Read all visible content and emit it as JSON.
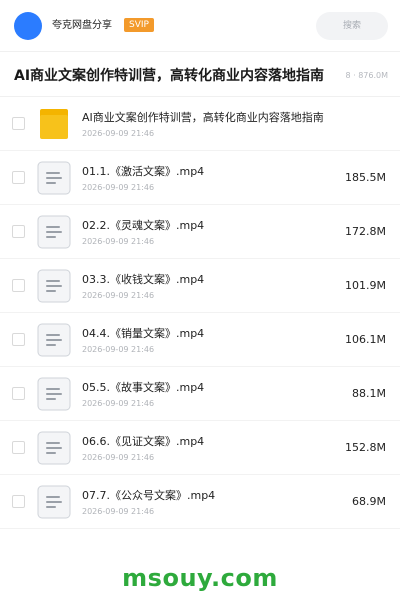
{
  "header": {
    "username": "夸克网盘分享",
    "badge": "SVIP",
    "search_placeholder": "搜索"
  },
  "folder": {
    "title": "AI商业文案创作特训营，高转化商业内容落地指南",
    "meta": "8 · 876.0M"
  },
  "files": [
    {
      "name": "AI商业文案创作特训营，高转化商业内容落地指南",
      "date": "2026-09-09 21:46",
      "size": "",
      "icon": "folder-icon"
    },
    {
      "name": "01.1.《激活文案》.mp4",
      "date": "2026-09-09 21:46",
      "size": "185.5M",
      "icon": "video-file-icon"
    },
    {
      "name": "02.2.《灵魂文案》.mp4",
      "date": "2026-09-09 21:46",
      "size": "172.8M",
      "icon": "video-file-icon"
    },
    {
      "name": "03.3.《收钱文案》.mp4",
      "date": "2026-09-09 21:46",
      "size": "101.9M",
      "icon": "video-file-icon"
    },
    {
      "name": "04.4.《销量文案》.mp4",
      "date": "2026-09-09 21:46",
      "size": "106.1M",
      "icon": "video-file-icon"
    },
    {
      "name": "05.5.《故事文案》.mp4",
      "date": "2026-09-09 21:46",
      "size": "88.1M",
      "icon": "video-file-icon"
    },
    {
      "name": "06.6.《见证文案》.mp4",
      "date": "2026-09-09 21:46",
      "size": "152.8M",
      "icon": "video-file-icon"
    },
    {
      "name": "07.7.《公众号文案》.mp4",
      "date": "2026-09-09 21:46",
      "size": "68.9M",
      "icon": "video-file-icon"
    }
  ],
  "watermark": "msouy.com",
  "colors": {
    "avatar": "#2b7cff",
    "badge": "#f39a2b",
    "folder": "#f7c21b",
    "watermark": "#2eaa3c"
  }
}
